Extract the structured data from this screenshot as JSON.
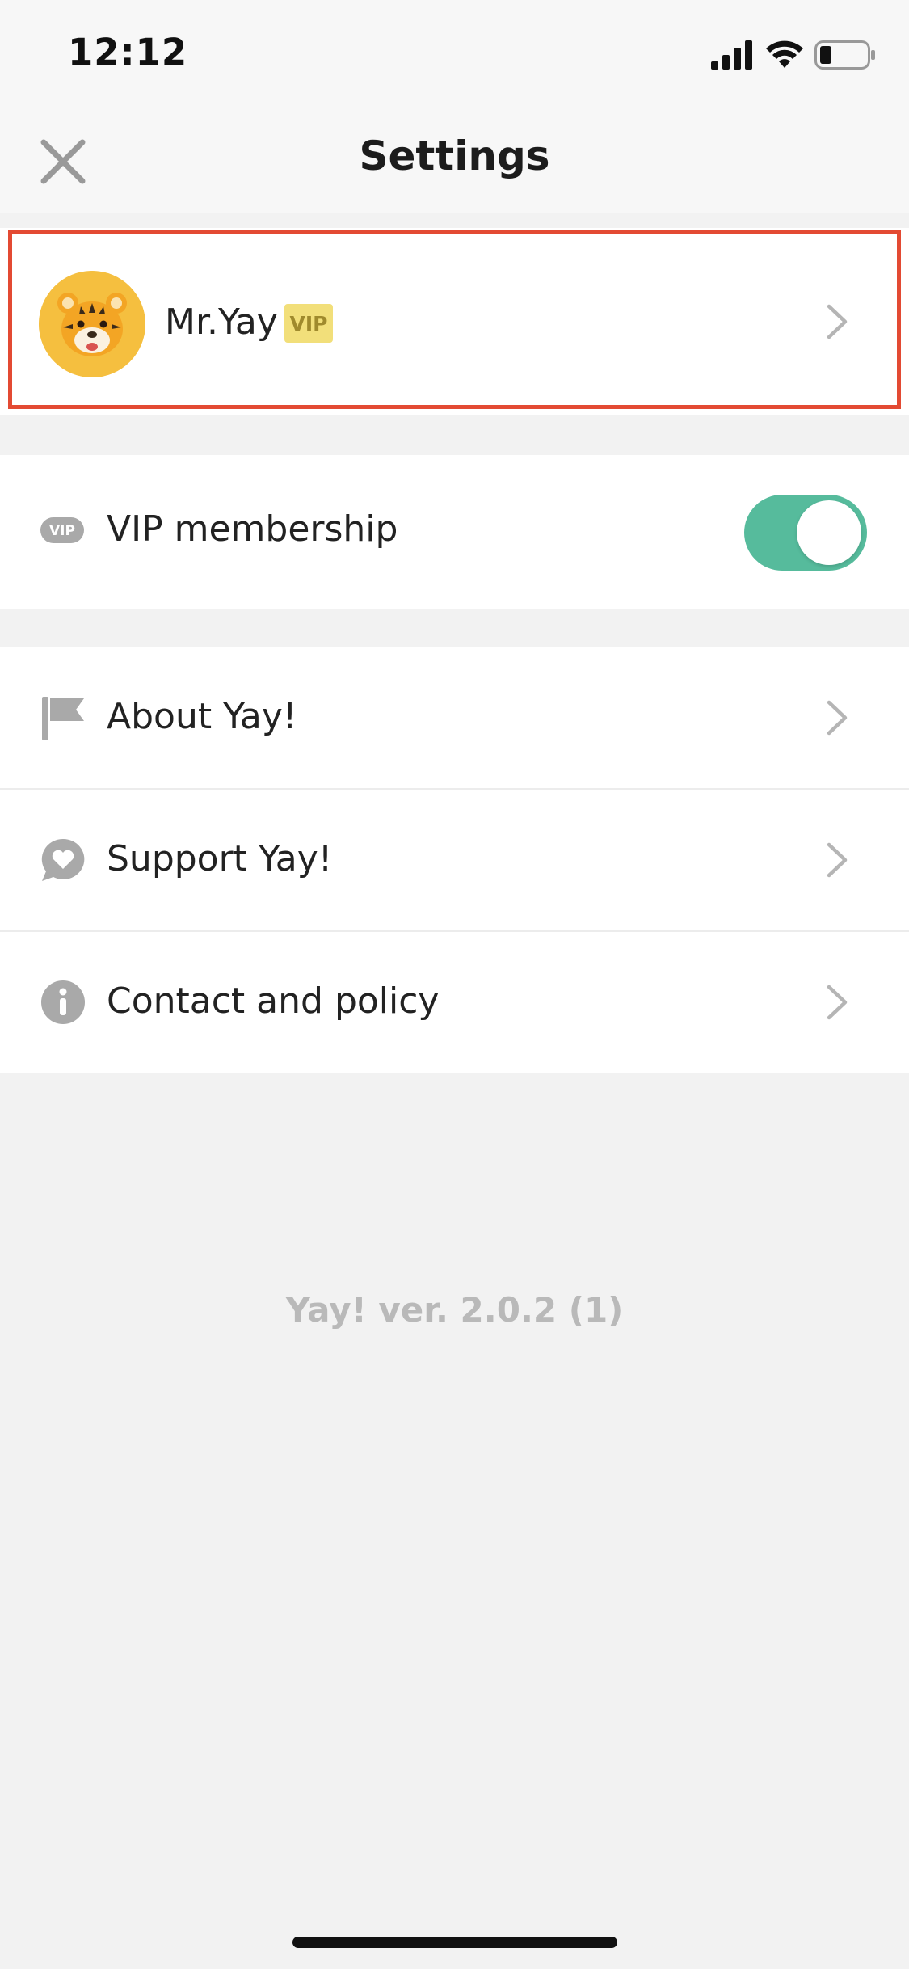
{
  "status_bar": {
    "time": "12:12",
    "icons": [
      "signal-icon",
      "wifi-icon",
      "battery-icon"
    ]
  },
  "header": {
    "title": "Settings",
    "close_icon": "close-icon"
  },
  "profile": {
    "name": "Mr.Yay",
    "badge": "VIP",
    "avatar_icon": "tiger-face-icon",
    "avatar_color": "#f5bf3f",
    "highlight_color": "#e34a33"
  },
  "vip_row": {
    "icon_text": "VIP",
    "label": "VIP membership",
    "toggle_on": true,
    "toggle_color": "#56bb9c"
  },
  "menu_items": [
    {
      "label": "About Yay!",
      "icon": "flag-icon"
    },
    {
      "label": "Support Yay!",
      "icon": "heart-bubble-icon"
    },
    {
      "label": "Contact and policy",
      "icon": "info-icon"
    }
  ],
  "footer": {
    "version": "Yay! ver. 2.0.2 (1)"
  }
}
